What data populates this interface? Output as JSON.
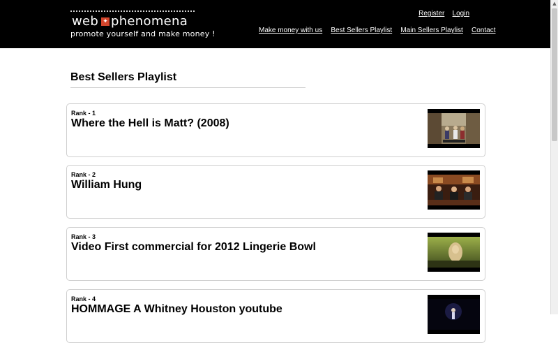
{
  "brand": {
    "word1": "web",
    "word2": "phenomena",
    "tagline": "promote yourself  and make money !"
  },
  "top_links": {
    "register": "Register",
    "login": "Login"
  },
  "nav": [
    "Make money with us",
    "Best Sellers Playlist",
    "Main Sellers Playlist",
    "Contact"
  ],
  "page_title": "Best Sellers Playlist",
  "items": [
    {
      "rank": "Rank - 1",
      "title": "Where the Hell is Matt? (2008)",
      "thumb_icon": "video-thumbnail-dancing"
    },
    {
      "rank": "Rank - 2",
      "title": "William Hung",
      "thumb_icon": "video-thumbnail-judges"
    },
    {
      "rank": "Rank - 3",
      "title": "Video First commercial for 2012 Lingerie Bowl",
      "thumb_icon": "video-thumbnail-portrait"
    },
    {
      "rank": "Rank - 4",
      "title": "HOMMAGE A Whitney Houston youtube",
      "thumb_icon": "video-thumbnail-stage"
    }
  ],
  "colors": {
    "header_bg": "#000000",
    "logo_accent": "#d2452c",
    "card_border": "#cfcfcf"
  }
}
